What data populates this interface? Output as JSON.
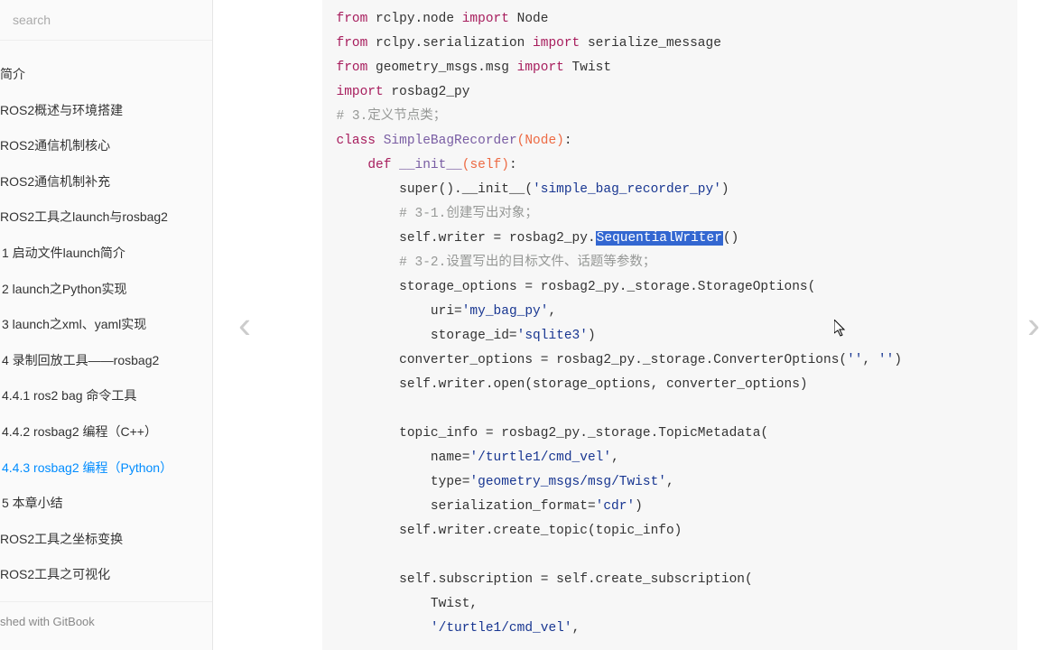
{
  "search": {
    "placeholder": "search"
  },
  "sidebar": {
    "items": [
      {
        "label": "简介",
        "active": false,
        "sub": false
      },
      {
        "label": "ROS2概述与环境搭建",
        "active": false,
        "sub": false
      },
      {
        "label": "ROS2通信机制核心",
        "active": false,
        "sub": false
      },
      {
        "label": "ROS2通信机制补充",
        "active": false,
        "sub": false
      },
      {
        "label": "ROS2工具之launch与rosbag2",
        "active": false,
        "sub": false
      },
      {
        "label": "1 启动文件launch简介",
        "active": false,
        "sub": true
      },
      {
        "label": "2 launch之Python实现",
        "active": false,
        "sub": true
      },
      {
        "label": "3 launch之xml、yaml实现",
        "active": false,
        "sub": true
      },
      {
        "label": "4 录制回放工具——rosbag2",
        "active": false,
        "sub": true
      },
      {
        "label": "4.4.1 ros2 bag 命令工具",
        "active": false,
        "sub": true
      },
      {
        "label": "4.4.2 rosbag2 编程（C++）",
        "active": false,
        "sub": true
      },
      {
        "label": "4.4.3 rosbag2 编程（Python）",
        "active": true,
        "sub": true
      },
      {
        "label": "5 本章小结",
        "active": false,
        "sub": true
      },
      {
        "label": "ROS2工具之坐标变换",
        "active": false,
        "sub": false
      },
      {
        "label": "ROS2工具之可视化",
        "active": false,
        "sub": false
      }
    ]
  },
  "footer": {
    "text": "shed with GitBook"
  },
  "code": {
    "l1_from": "from",
    "l1_mod": " rclpy.node ",
    "l1_import": "import",
    "l1_rest": " Node",
    "l2_from": "from",
    "l2_mod": " rclpy.serialization ",
    "l2_import": "import",
    "l2_rest": " serialize_message",
    "l3_from": "from",
    "l3_mod": " geometry_msgs.msg ",
    "l3_import": "import",
    "l3_rest": " Twist",
    "l4_import": "import",
    "l4_rest": " rosbag2_py",
    "l5_cm": "# 3.定义节点类；",
    "l6_class": "class",
    "l6_sp": " ",
    "l6_name": "SimpleBagRecorder",
    "l6_paren_open": "(",
    "l6_base": "Node",
    "l6_paren_close": ")",
    "l6_colon": ":",
    "l7_indent": "    ",
    "l7_def": "def",
    "l7_sp": " ",
    "l7_fn": "__init__",
    "l7_paren_open": "(",
    "l7_self": "self",
    "l7_paren_close": ")",
    "l7_colon": ":",
    "l8_indent": "        ",
    "l8_code": "super().__init__(",
    "l8_str": "'simple_bag_recorder_py'",
    "l8_end": ")",
    "l9_indent": "        ",
    "l9_cm": "# 3-1.创建写出对象；",
    "l10_indent": "        ",
    "l10_a": "self.writer = rosbag2_py.",
    "l10_hl": "SequentialWriter",
    "l10_b": "()",
    "l11_indent": "        ",
    "l11_cm": "# 3-2.设置写出的目标文件、话题等参数；",
    "l12_indent": "        ",
    "l12_code": "storage_options = rosbag2_py._storage.StorageOptions(",
    "l13_indent": "            ",
    "l13_a": "uri=",
    "l13_str": "'my_bag_py'",
    "l13_b": ",",
    "l14_indent": "            ",
    "l14_a": "storage_id=",
    "l14_str": "'sqlite3'",
    "l14_b": ")",
    "l15_indent": "        ",
    "l15_a": "converter_options = rosbag2_py._storage.ConverterOptions(",
    "l15_s1": "''",
    "l15_m": ", ",
    "l15_s2": "''",
    "l15_b": ")",
    "l16_indent": "        ",
    "l16_code": "self.writer.open(storage_options, converter_options)",
    "blank": "",
    "l18_indent": "        ",
    "l18_code": "topic_info = rosbag2_py._storage.TopicMetadata(",
    "l19_indent": "            ",
    "l19_a": "name=",
    "l19_str": "'/turtle1/cmd_vel'",
    "l19_b": ",",
    "l20_indent": "            ",
    "l20_a": "type=",
    "l20_str": "'geometry_msgs/msg/Twist'",
    "l20_b": ",",
    "l21_indent": "            ",
    "l21_a": "serialization_format=",
    "l21_str": "'cdr'",
    "l21_b": ")",
    "l22_indent": "        ",
    "l22_code": "self.writer.create_topic(topic_info)",
    "l24_indent": "        ",
    "l24_code": "self.subscription = self.create_subscription(",
    "l25_indent": "            ",
    "l25_code": "Twist,",
    "l26_indent": "            ",
    "l26_str": "'/turtle1/cmd_vel'",
    "l26_b": ","
  }
}
